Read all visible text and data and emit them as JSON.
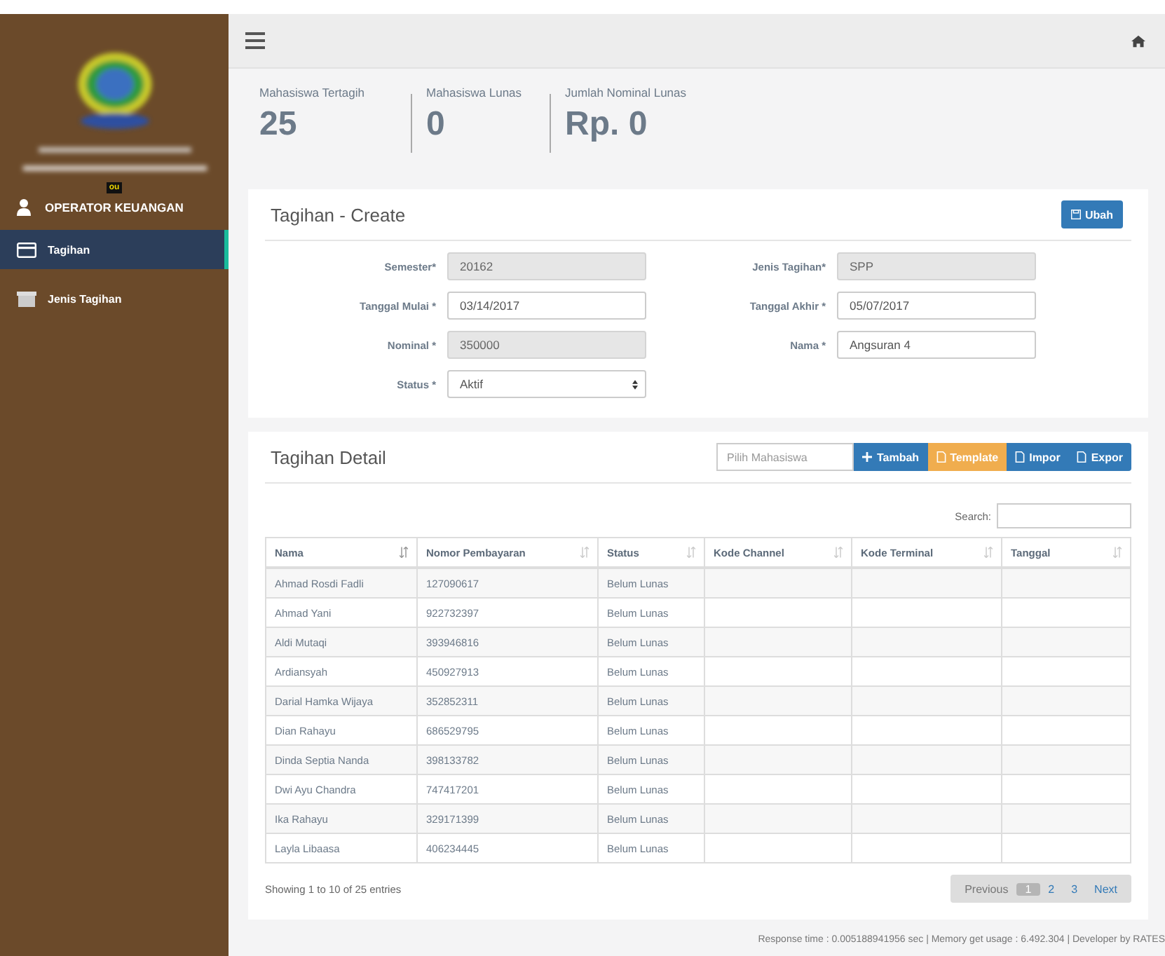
{
  "sidebar": {
    "badge": "ou",
    "user": "OPERATOR KEUANGAN",
    "items": [
      {
        "label": "Tagihan",
        "selected": true
      },
      {
        "label": "Jenis Tagihan",
        "selected": false
      }
    ]
  },
  "stats": [
    {
      "label": "Mahasiswa Tertagih",
      "value": "25"
    },
    {
      "label": "Mahasiswa Lunas",
      "value": "0"
    },
    {
      "label": "Jumlah Nominal Lunas",
      "value": "Rp. 0"
    }
  ],
  "form": {
    "title": "Tagihan - Create",
    "save_button": "Ubah",
    "fields": [
      {
        "label": "Semester*",
        "value": "20162",
        "kind": "text",
        "disabled": true
      },
      {
        "label": "Jenis Tagihan*",
        "value": "SPP",
        "kind": "text",
        "disabled": true
      },
      {
        "label": "Tanggal Mulai *",
        "value": "03/14/2017",
        "kind": "text",
        "disabled": false
      },
      {
        "label": "Tanggal Akhir *",
        "value": "05/07/2017",
        "kind": "text",
        "disabled": false
      },
      {
        "label": "Nominal *",
        "value": "350000",
        "kind": "text",
        "disabled": true
      },
      {
        "label": "Nama *",
        "value": "Angsuran 4",
        "kind": "text",
        "disabled": false
      },
      {
        "label": "Status *",
        "value": "Aktif",
        "kind": "select",
        "disabled": false
      }
    ]
  },
  "detail": {
    "title": "Tagihan Detail",
    "student_field": {
      "placeholder": "Pilih Mahasiswa"
    },
    "buttons": [
      {
        "label": "Tambah",
        "color": "#337ab7"
      },
      {
        "label": "Template",
        "color": "#f0ad4e"
      },
      {
        "label": "Impor",
        "color": "#337ab7"
      },
      {
        "label": "Expor",
        "color": "#337ab7"
      }
    ],
    "search_label": "Search:",
    "table": {
      "columns": [
        {
          "label": "Nama",
          "sorted": true
        },
        {
          "label": "Nomor Pembayaran",
          "sorted": false
        },
        {
          "label": "Status",
          "sorted": false
        },
        {
          "label": "Kode Channel",
          "sorted": false
        },
        {
          "label": "Kode Terminal",
          "sorted": false
        },
        {
          "label": "Tanggal",
          "sorted": false
        }
      ],
      "rows": [
        [
          "Ahmad Rosdi Fadli",
          "127090617",
          "Belum Lunas",
          "",
          "",
          ""
        ],
        [
          "Ahmad Yani",
          "922732397",
          "Belum Lunas",
          "",
          "",
          ""
        ],
        [
          "Aldi Mutaqi",
          "393946816",
          "Belum Lunas",
          "",
          "",
          ""
        ],
        [
          "Ardiansyah",
          "450927913",
          "Belum Lunas",
          "",
          "",
          ""
        ],
        [
          "Darial Hamka Wijaya",
          "352852311",
          "Belum Lunas",
          "",
          "",
          ""
        ],
        [
          "Dian Rahayu",
          "686529795",
          "Belum Lunas",
          "",
          "",
          ""
        ],
        [
          "Dinda Septia Nanda",
          "398133782",
          "Belum Lunas",
          "",
          "",
          ""
        ],
        [
          "Dwi Ayu Chandra",
          "747417201",
          "Belum Lunas",
          "",
          "",
          ""
        ],
        [
          "Ika Rahayu",
          "329171399",
          "Belum Lunas",
          "",
          "",
          ""
        ],
        [
          "Layla Libaasa",
          "406234445",
          "Belum Lunas",
          "",
          "",
          ""
        ]
      ]
    },
    "info": "Showing 1 to 10 of 25 entries",
    "pagination": {
      "previous": "Previous",
      "next": "Next",
      "pages": [
        {
          "label": "1",
          "selected": true
        },
        {
          "label": "2",
          "selected": false
        },
        {
          "label": "3",
          "selected": false
        }
      ]
    }
  },
  "footer": "Response time : 0.005188941956 sec | Memory get usage : 6.492.304 | Developer by RATES"
}
